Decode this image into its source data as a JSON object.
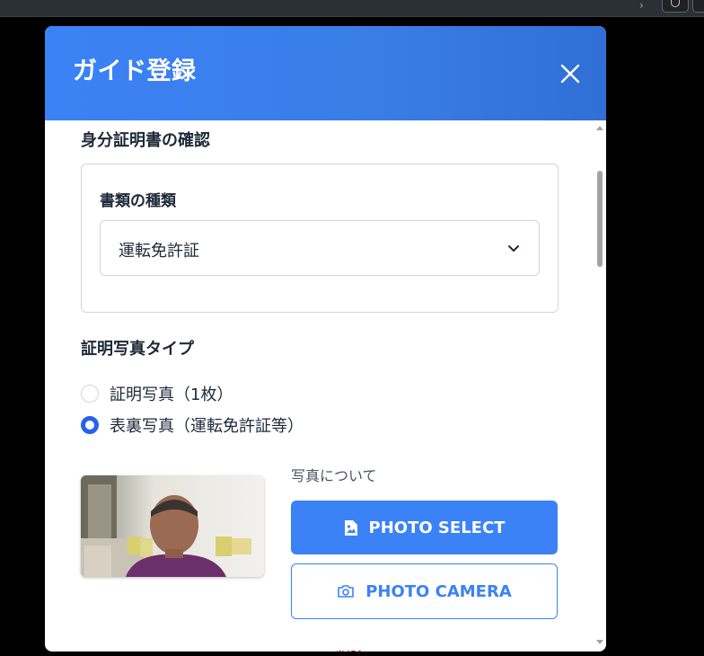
{
  "modal": {
    "title": "ガイド登録",
    "close_icon": "close-icon"
  },
  "identity": {
    "section_title": "身分証明書の確認",
    "doc_type_label": "書類の種類",
    "doc_type_value": "運転免許証"
  },
  "photo_type": {
    "section_title": "証明写真タイプ",
    "options": [
      {
        "label": "証明写真（1枚）",
        "checked": false
      },
      {
        "label": "表裏写真（運転免許証等）",
        "checked": true
      }
    ]
  },
  "photo": {
    "caption": "写真について",
    "select_label": "PHOTO SELECT",
    "camera_label": "PHOTO CAMERA",
    "delete_label": "削除",
    "colors": {
      "primary": "#3b82f6",
      "danger": "#dc2626"
    }
  }
}
